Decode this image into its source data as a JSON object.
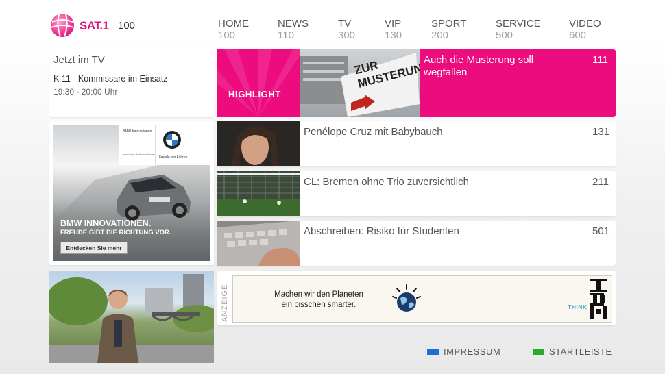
{
  "header": {
    "brand": "SAT.1",
    "page_number": "100",
    "nav": [
      {
        "label": "HOME",
        "num": "100"
      },
      {
        "label": "NEWS",
        "num": "110"
      },
      {
        "label": "TV",
        "num": "300"
      },
      {
        "label": "VIP",
        "num": "130"
      },
      {
        "label": "SPORT",
        "num": "200"
      },
      {
        "label": "SERVICE",
        "num": "500"
      },
      {
        "label": "VIDEO",
        "num": "600"
      }
    ]
  },
  "now_on_tv": {
    "title": "Jetzt im TV",
    "show": "K 11 - Kommissare im Einsatz",
    "time": "19:30 - 20:00 Uhr"
  },
  "highlight": {
    "label": "HIGHLIGHT",
    "title": "Auch die Musterung soll wegfallen",
    "page": "111",
    "image_text": "ZUR MUSTERUNG"
  },
  "news": [
    {
      "title": "Penélope Cruz mit Babybauch",
      "page": "131"
    },
    {
      "title": "CL: Bremen ohne Trio zuversichtlich",
      "page": "211"
    },
    {
      "title": "Abschreiben: Risiko für Studenten",
      "page": "501"
    }
  ],
  "bmw_ad": {
    "top_label": "BMW Innovationen",
    "top_small": "www.bmw.de/innovationen",
    "logo_text": "BMW",
    "tagline_small": "Freude am Fahren",
    "headline": "BMW INNOVATIONEN.",
    "subline": "FREUDE GIBT DIE RICHTUNG VOR.",
    "cta": "Entdecken Sie mehr"
  },
  "ibm_ad": {
    "anzeige": "ANZEIGE",
    "line1": "Machen wir den Planeten",
    "line2": "ein bisschen smarter.",
    "think": "THINK",
    "logo_text": "IBM"
  },
  "footer": {
    "impressum": "IMPRESSUM",
    "startleiste": "STARTLEISTE"
  },
  "colors": {
    "brand_pink": "#ec0c7e",
    "impressum_blue": "#1f6fd1",
    "startleiste_green": "#2ea82e"
  }
}
